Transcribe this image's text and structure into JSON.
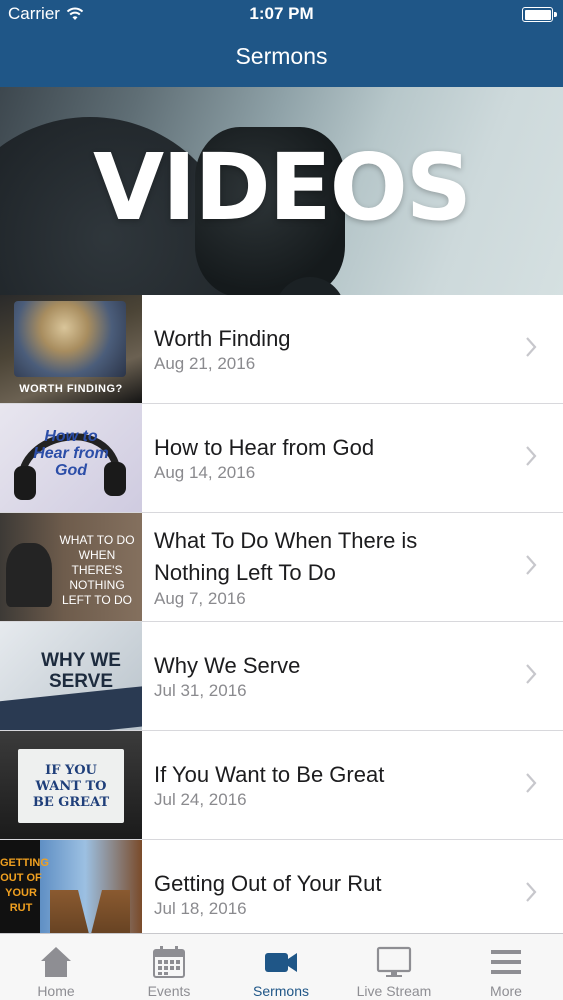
{
  "status_bar": {
    "carrier": "Carrier",
    "time": "1:07 PM"
  },
  "nav": {
    "title": "Sermons"
  },
  "hero": {
    "text": "VIDEOS"
  },
  "sermons": [
    {
      "title_line1": "Worth Finding",
      "title_line2": "",
      "date": "Aug 21, 2016",
      "thumb_text": "Worth Finding?"
    },
    {
      "title_line1": "How to Hear from God",
      "title_line2": "",
      "date": "Aug 14, 2016",
      "thumb_text": "How to Hear from God"
    },
    {
      "title_line1": "What To Do When There is",
      "title_line2": "Nothing Left To Do",
      "date": "Aug 7, 2016",
      "thumb_text": "What to do when there's Nothing left to do"
    },
    {
      "title_line1": "Why We Serve",
      "title_line2": "",
      "date": "Jul 31, 2016",
      "thumb_text": "Why We Serve"
    },
    {
      "title_line1": "If You Want to Be Great",
      "title_line2": "",
      "date": "Jul 24, 2016",
      "thumb_text": "If you want to be Great"
    },
    {
      "title_line1": "Getting Out of Your Rut",
      "title_line2": "",
      "date": "Jul 18, 2016",
      "thumb_text": "Getting Out of Your Rut"
    }
  ],
  "tabs": [
    {
      "label": "Home",
      "icon": "home-icon",
      "active": false
    },
    {
      "label": "Events",
      "icon": "calendar-icon",
      "active": false
    },
    {
      "label": "Sermons",
      "icon": "video-camera-icon",
      "active": true
    },
    {
      "label": "Live Stream",
      "icon": "monitor-icon",
      "active": false
    },
    {
      "label": "More",
      "icon": "menu-icon",
      "active": false
    }
  ],
  "colors": {
    "primary": "#1f5687",
    "tab_inactive": "#8e8e93",
    "separator": "#d8d8dc"
  }
}
